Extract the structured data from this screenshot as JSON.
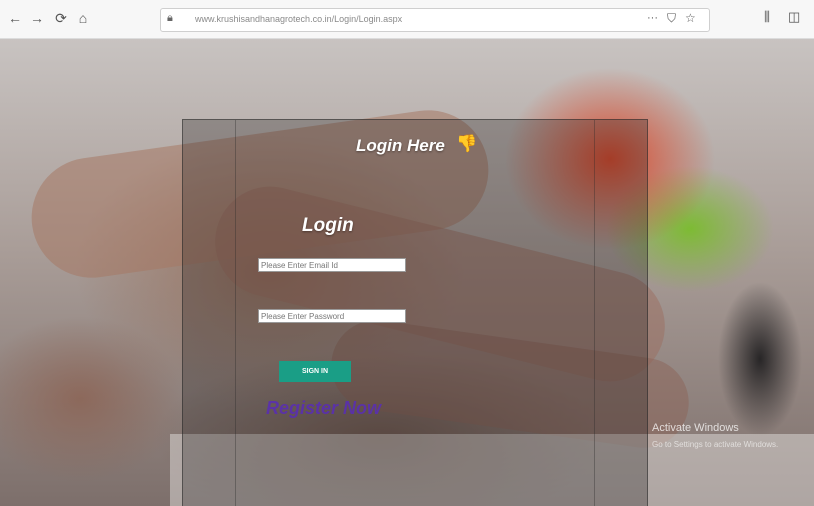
{
  "browser": {
    "back_icon": "←",
    "forward_icon": "→",
    "reload_icon": "⟳",
    "home_icon": "⌂",
    "url": "www.krushisandhanagrotech.co.in/Login/Login.aspx",
    "page_actions_icon": "···",
    "pocket_icon": "⛉",
    "bookmark_icon": "☆",
    "library_icon": "⫼",
    "sidebar_icon": "◫"
  },
  "page": {
    "heading": "Login Here",
    "heading_icon": "thumbs-down-icon",
    "heading_icon_glyph": "👎",
    "form_title": "Login",
    "email_placeholder": "Please Enter Email Id",
    "password_placeholder": "Please Enter Password",
    "signin_label": "SIGN IN",
    "register_link": "Register Now"
  },
  "windows_watermark": {
    "line1": "Activate Windows",
    "line2": "Go to Settings to activate Windows."
  },
  "colors": {
    "signin_button": "#1a9e86",
    "register_link": "#5a2fb0"
  }
}
